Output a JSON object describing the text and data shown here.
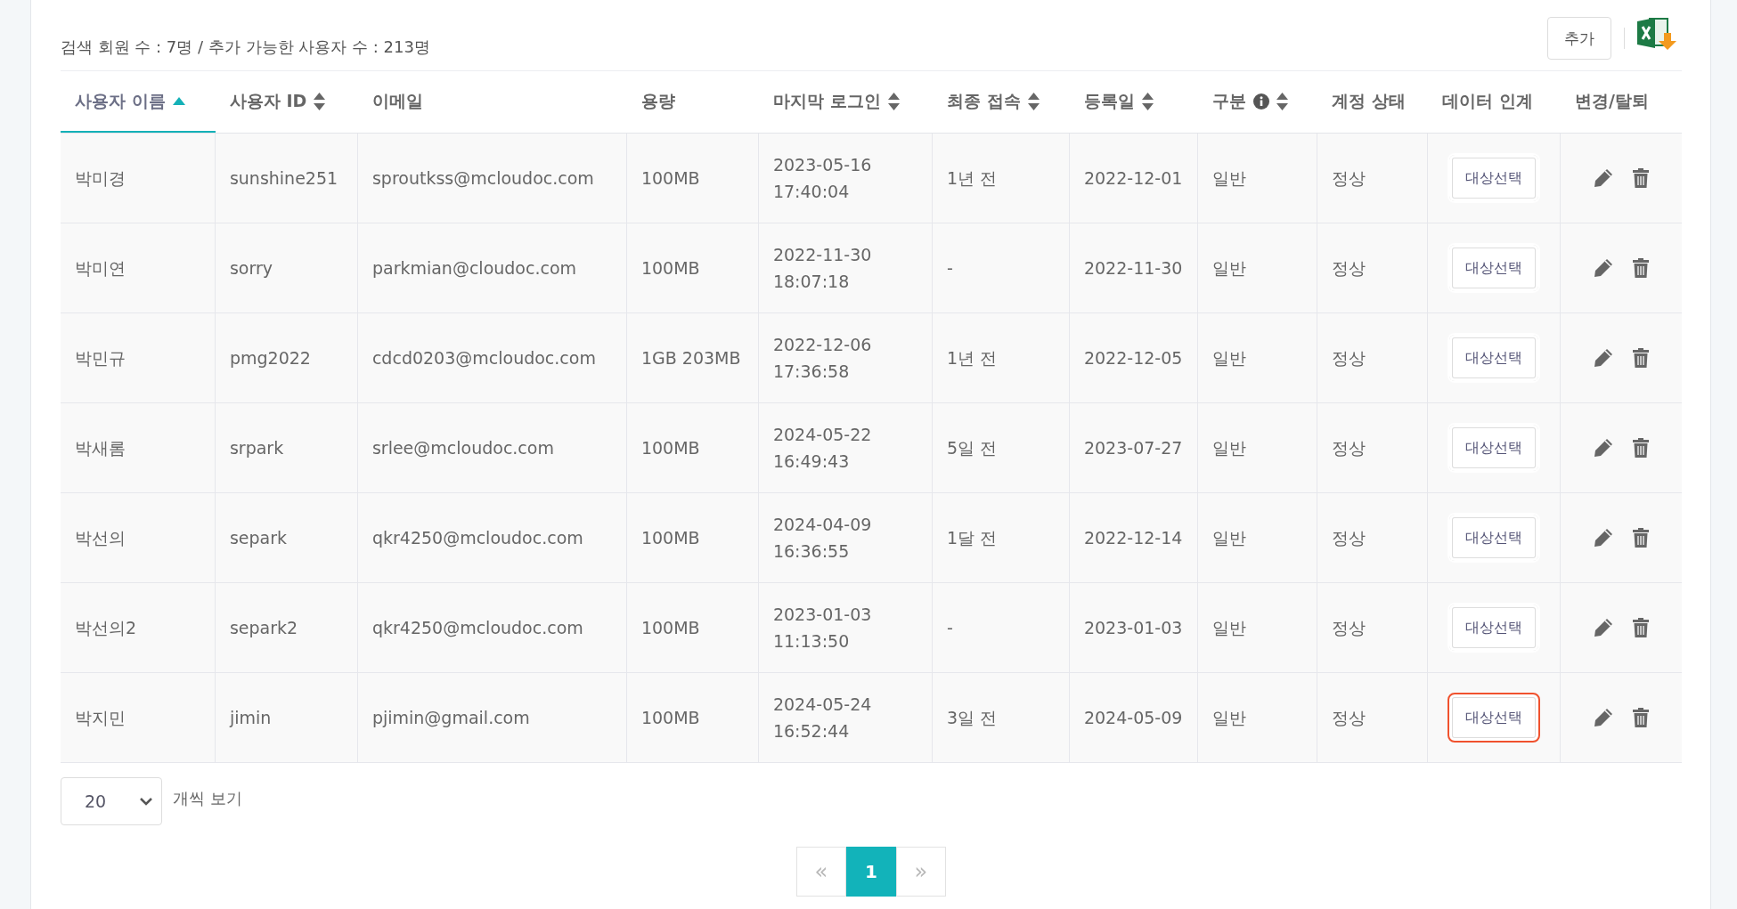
{
  "summary": "검색 회원 수 : 7명 / 추가 가능한 사용자 수 : 213명",
  "toolbar": {
    "add_button": "추가"
  },
  "table": {
    "columns": [
      {
        "label": "사용자 이름",
        "sortable": true,
        "selected": true,
        "info": false
      },
      {
        "label": "사용자 ID",
        "sortable": true,
        "selected": false,
        "info": false
      },
      {
        "label": "이메일",
        "sortable": false,
        "selected": false,
        "info": false
      },
      {
        "label": "용량",
        "sortable": false,
        "selected": false,
        "info": false
      },
      {
        "label": "마지막 로그인",
        "sortable": true,
        "selected": false,
        "info": false
      },
      {
        "label": "최종 접속",
        "sortable": true,
        "selected": false,
        "info": false
      },
      {
        "label": "등록일",
        "sortable": true,
        "selected": false,
        "info": false
      },
      {
        "label": "구분",
        "sortable": true,
        "selected": false,
        "info": true
      },
      {
        "label": "계정 상태",
        "sortable": false,
        "selected": false,
        "info": false
      },
      {
        "label": "데이터 인계",
        "sortable": false,
        "selected": false,
        "info": false
      },
      {
        "label": "변경/탈퇴",
        "sortable": false,
        "selected": false,
        "info": false
      }
    ],
    "rows": [
      {
        "name": "박미경",
        "id": "sunshine251",
        "email": "sproutkss@mcloudoc.com",
        "storage": "100MB",
        "login_date": "2023-05-16",
        "login_time": "17:40:04",
        "last_access": "1년 전",
        "registered": "2022-12-01",
        "type": "일반",
        "status": "정상",
        "transfer": "대상선택",
        "highlighted": false
      },
      {
        "name": "박미연",
        "id": "sorry",
        "email": "parkmian@cloudoc.com",
        "storage": "100MB",
        "login_date": "2022-11-30",
        "login_time": "18:07:18",
        "last_access": "-",
        "registered": "2022-11-30",
        "type": "일반",
        "status": "정상",
        "transfer": "대상선택",
        "highlighted": false
      },
      {
        "name": "박민규",
        "id": "pmg2022",
        "email": "cdcd0203@mcloudoc.com",
        "storage": "1GB 203MB",
        "login_date": "2022-12-06",
        "login_time": "17:36:58",
        "last_access": "1년 전",
        "registered": "2022-12-05",
        "type": "일반",
        "status": "정상",
        "transfer": "대상선택",
        "highlighted": false
      },
      {
        "name": "박새롬",
        "id": "srpark",
        "email": "srlee@mcloudoc.com",
        "storage": "100MB",
        "login_date": "2024-05-22",
        "login_time": "16:49:43",
        "last_access": "5일 전",
        "registered": "2023-07-27",
        "type": "일반",
        "status": "정상",
        "transfer": "대상선택",
        "highlighted": false
      },
      {
        "name": "박선의",
        "id": "separk",
        "email": "qkr4250@mcloudoc.com",
        "storage": "100MB",
        "login_date": "2024-04-09",
        "login_time": "16:36:55",
        "last_access": "1달 전",
        "registered": "2022-12-14",
        "type": "일반",
        "status": "정상",
        "transfer": "대상선택",
        "highlighted": false
      },
      {
        "name": "박선의2",
        "id": "separk2",
        "email": "qkr4250@mcloudoc.com",
        "storage": "100MB",
        "login_date": "2023-01-03",
        "login_time": "11:13:50",
        "last_access": "-",
        "registered": "2023-01-03",
        "type": "일반",
        "status": "정상",
        "transfer": "대상선택",
        "highlighted": false
      },
      {
        "name": "박지민",
        "id": "jimin",
        "email": "pjimin@gmail.com",
        "storage": "100MB",
        "login_date": "2024-05-24",
        "login_time": "16:52:44",
        "last_access": "3일 전",
        "registered": "2024-05-09",
        "type": "일반",
        "status": "정상",
        "transfer": "대상선택",
        "highlighted": true
      }
    ]
  },
  "page_size": {
    "value": "20",
    "label": "개씩 보기"
  },
  "pagination": [
    {
      "label": "«",
      "kind": "prev",
      "selected": false,
      "disabled": true
    },
    {
      "label": "1",
      "kind": "page",
      "selected": true,
      "disabled": false
    },
    {
      "label": "»",
      "kind": "next",
      "selected": false,
      "disabled": true
    }
  ]
}
